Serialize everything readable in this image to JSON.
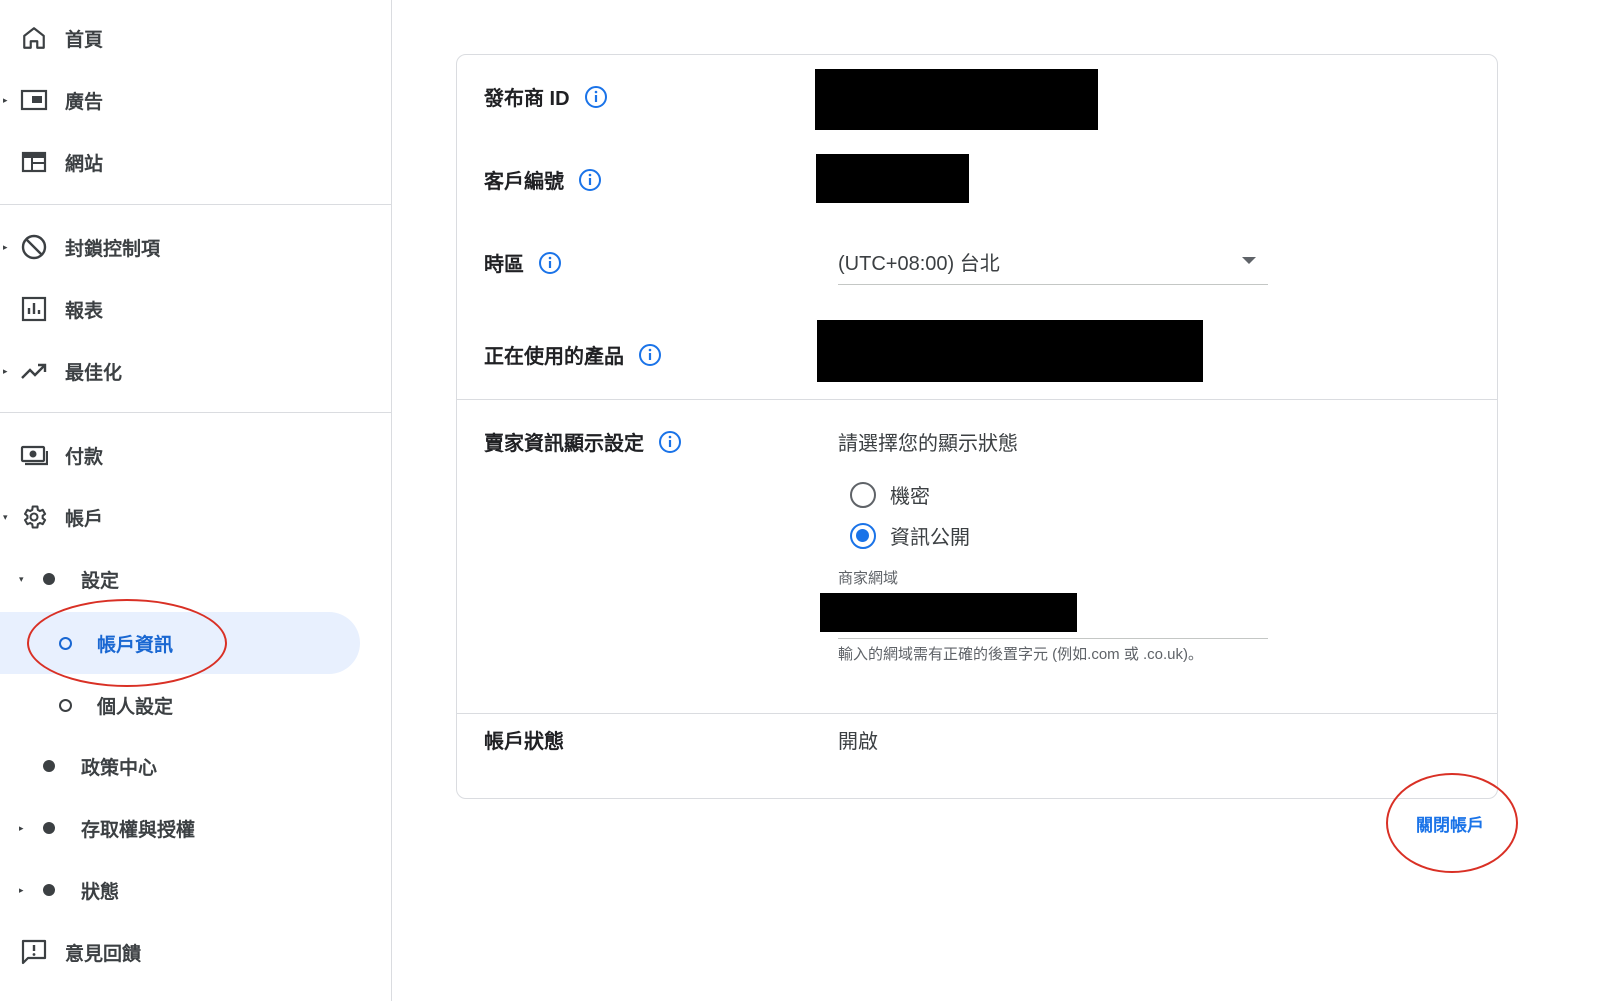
{
  "sidebar": {
    "items": [
      {
        "label": "首頁",
        "icon": "home-icon"
      },
      {
        "label": "廣告",
        "icon": "ads-icon"
      },
      {
        "label": "網站",
        "icon": "sites-icon"
      },
      {
        "label": "封鎖控制項",
        "icon": "block-icon"
      },
      {
        "label": "報表",
        "icon": "reports-icon"
      },
      {
        "label": "最佳化",
        "icon": "optimization-icon"
      },
      {
        "label": "付款",
        "icon": "payments-icon"
      },
      {
        "label": "帳戶",
        "icon": "gear-icon"
      }
    ],
    "account_sub": {
      "settings": "設定",
      "account_info": "帳戶資訊",
      "personal_settings": "個人設定",
      "policy_center": "政策中心",
      "access": "存取權與授權",
      "status": "狀態"
    },
    "feedback": {
      "label": "意見回饋",
      "icon": "feedback-icon"
    }
  },
  "card": {
    "publisher_id_label": "發布商 ID",
    "customer_id_label": "客戶編號",
    "timezone_label": "時區",
    "timezone_value": "(UTC+08:00) 台北",
    "products_label": "正在使用的產品",
    "seller_info_label": "賣家資訊顯示設定",
    "seller_prompt": "請選擇您的顯示狀態",
    "radio_options": [
      {
        "label": "機密",
        "checked": false
      },
      {
        "label": "資訊公開",
        "checked": true
      }
    ],
    "domain_label": "商家網域",
    "domain_helper": "輸入的網域需有正確的後置字元 (例如.com 或 .co.uk)。",
    "account_status_label": "帳戶狀態",
    "account_status_value": "開啟"
  },
  "close_account": "關閉帳戶",
  "colors": {
    "accent": "#1a73e8",
    "active_bg": "#e8f0fe",
    "annotation": "#d93025"
  }
}
